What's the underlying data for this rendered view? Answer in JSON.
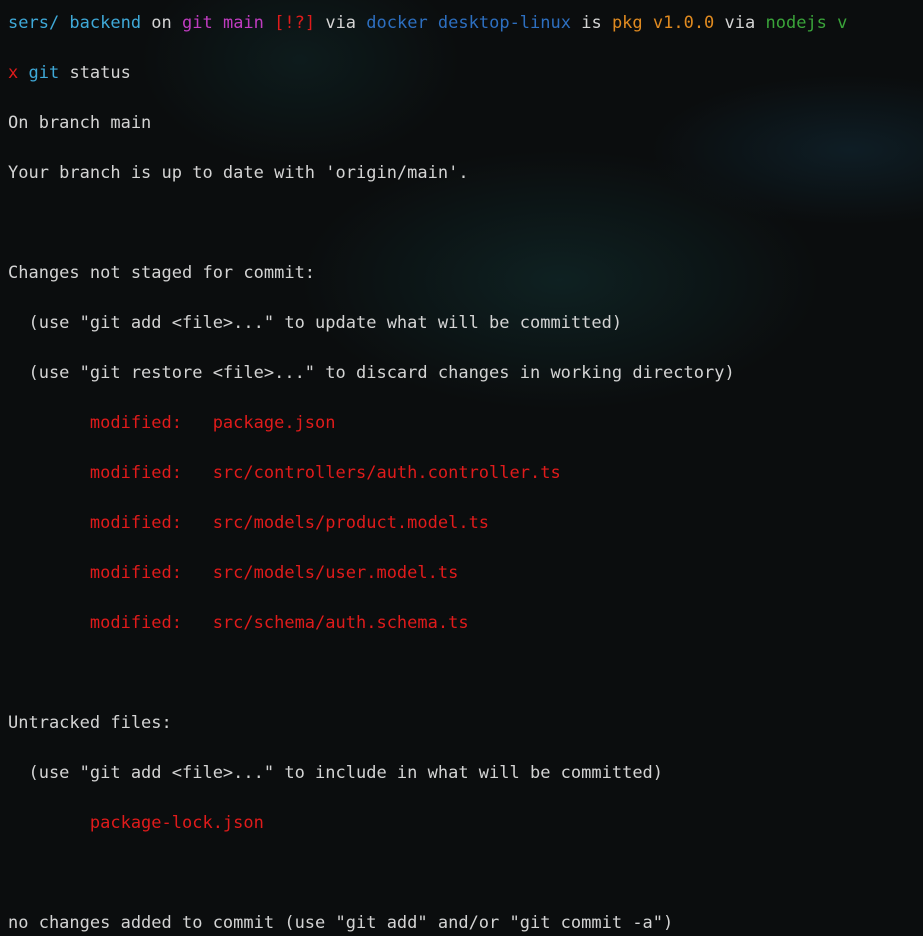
{
  "prompt": {
    "dir": "sers/ backend",
    "on": " on ",
    "branch": "git main",
    "status": " [!?]",
    "via1": " via ",
    "docker": "docker desktop-linux",
    "is": " is ",
    "pkg": "pkg v1.0.0",
    "via2": " via ",
    "node": "nodejs v"
  },
  "command": {
    "marker": "x",
    "cmd": "git",
    "args": " status"
  },
  "output": {
    "l1": "On branch main",
    "l2": "Your branch is up to date with 'origin/main'.",
    "l3": "Changes not staged for commit:",
    "l4": "  (use \"git add <file>...\" to update what will be committed)",
    "l5": "  (use \"git restore <file>...\" to discard changes in working directory)",
    "modified": [
      "        modified:   package.json",
      "        modified:   src/controllers/auth.controller.ts",
      "        modified:   src/models/product.model.ts",
      "        modified:   src/models/user.model.ts",
      "        modified:   src/schema/auth.schema.ts"
    ],
    "l6": "Untracked files:",
    "l7": "  (use \"git add <file>...\" to include in what will be committed)",
    "untracked": "        package-lock.json",
    "l8": "no changes added to commit (use \"git add\" and/or \"git commit -a\")"
  }
}
